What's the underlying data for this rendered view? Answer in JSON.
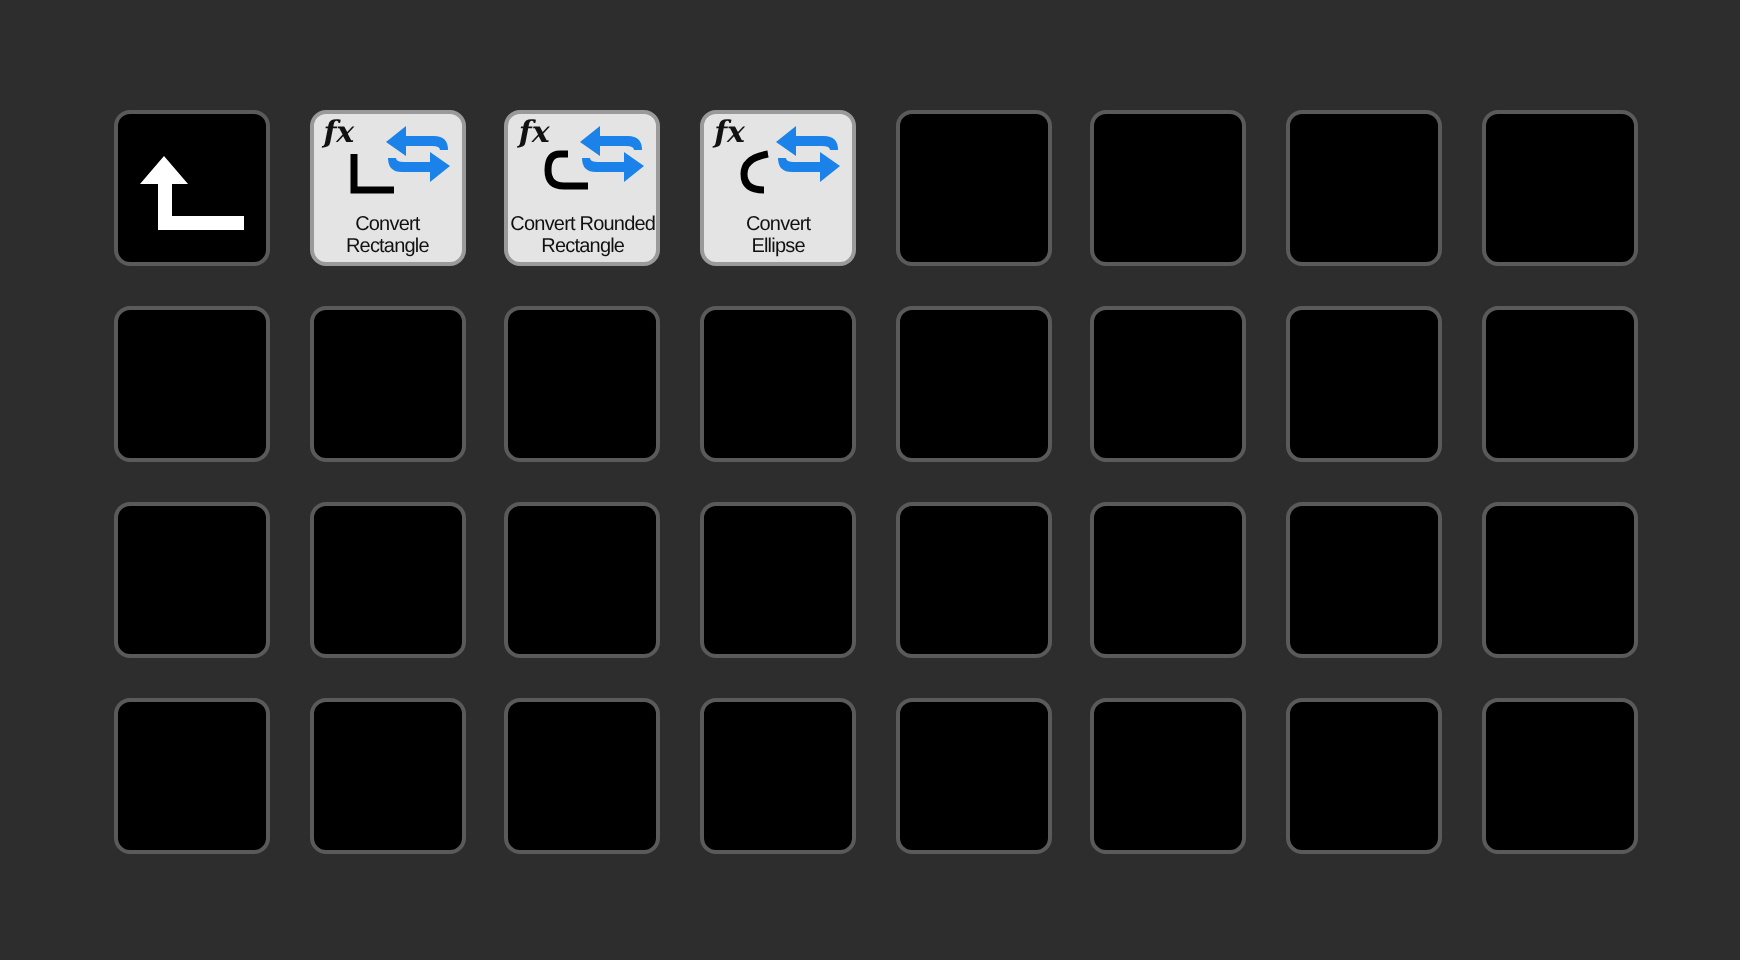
{
  "keys": [
    {
      "kind": "back"
    },
    {
      "kind": "rectangle",
      "badge": "fx",
      "lines": [
        "Convert",
        "Rectangle"
      ]
    },
    {
      "kind": "rounded",
      "badge": "fx",
      "lines": [
        "Convert Rounded",
        "Rectangle"
      ]
    },
    {
      "kind": "ellipse",
      "badge": "fx",
      "lines": [
        "Convert",
        "Ellipse"
      ]
    },
    {
      "kind": "empty"
    },
    {
      "kind": "empty"
    },
    {
      "kind": "empty"
    },
    {
      "kind": "empty"
    },
    {
      "kind": "empty"
    },
    {
      "kind": "empty"
    },
    {
      "kind": "empty"
    },
    {
      "kind": "empty"
    },
    {
      "kind": "empty"
    },
    {
      "kind": "empty"
    },
    {
      "kind": "empty"
    },
    {
      "kind": "empty"
    },
    {
      "kind": "empty"
    },
    {
      "kind": "empty"
    },
    {
      "kind": "empty"
    },
    {
      "kind": "empty"
    },
    {
      "kind": "empty"
    },
    {
      "kind": "empty"
    },
    {
      "kind": "empty"
    },
    {
      "kind": "empty"
    },
    {
      "kind": "empty"
    },
    {
      "kind": "empty"
    },
    {
      "kind": "empty"
    },
    {
      "kind": "empty"
    },
    {
      "kind": "empty"
    },
    {
      "kind": "empty"
    },
    {
      "kind": "empty"
    },
    {
      "kind": "empty"
    }
  ]
}
